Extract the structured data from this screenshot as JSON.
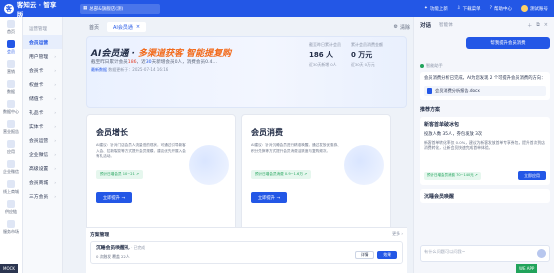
{
  "topbar": {
    "logo_text": "客知云 · 智享版",
    "logo_mark": "客",
    "store_name": "总部&旗舰店(测)",
    "actions": [
      "功能上新",
      "下载菜单",
      "帮助中心",
      "测试账号"
    ]
  },
  "iconbar": {
    "items": [
      {
        "label": "首页",
        "icon": "home-icon"
      },
      {
        "label": "会员",
        "icon": "member-icon",
        "active": true
      },
      {
        "label": "营销",
        "icon": "marketing-icon"
      },
      {
        "label": "数据",
        "icon": "data-icon"
      },
      {
        "label": "数据中心",
        "icon": "chart-icon"
      },
      {
        "label": "营业报告",
        "icon": "report-icon"
      },
      {
        "label": "应用",
        "icon": "app-icon"
      },
      {
        "label": "企业微信",
        "icon": "wechat-icon"
      },
      {
        "label": "线上商城",
        "icon": "mall-icon"
      },
      {
        "label": "供应链",
        "icon": "supply-icon"
      },
      {
        "label": "服务市场",
        "icon": "market-icon"
      }
    ]
  },
  "submenu": {
    "title": "运营管理",
    "items": [
      {
        "label": "会员运营",
        "active": true,
        "caret": ""
      },
      {
        "label": "用户管理",
        "caret": "›"
      },
      {
        "label": "会员卡",
        "caret": "›"
      },
      {
        "label": "权益卡",
        "caret": "›"
      },
      {
        "label": "储值卡",
        "caret": "›"
      },
      {
        "label": "礼品卡",
        "caret": "›"
      },
      {
        "label": "实体卡",
        "caret": "›"
      },
      {
        "label": "会员运营",
        "caret": "›"
      },
      {
        "label": "企业微信",
        "caret": "›"
      },
      {
        "label": "高级设置",
        "caret": "›"
      },
      {
        "label": "会员商城",
        "caret": "›"
      },
      {
        "label": "三方会员",
        "caret": "›"
      }
    ]
  },
  "tabs": {
    "items": [
      {
        "label": "首页",
        "active": false
      },
      {
        "label": "AI会员通",
        "active": true
      }
    ],
    "close_glyph": "×",
    "clear_label": "清除"
  },
  "hero": {
    "title_plain": "AI会员通 · ",
    "title_highlight": "多渠道获客 智能提复购",
    "sub_prefix": "截至昨日累计会员",
    "sub_num1": "186",
    "sub_mid": "，近",
    "sub_num2": "30",
    "sub_suffix": "天新增会员0人，消费会员0.4…",
    "meta_prefix": "最新数据",
    "meta_text": "数据更新于：2025-07-14 16:16",
    "stat1": {
      "label": "截至昨日累计会员",
      "value": "186 人",
      "foot": "近30天新增 0人"
    },
    "stat2": {
      "label": "累计会员消费金额",
      "value": "0 万元",
      "foot": "近30天 0万元"
    }
  },
  "cards": [
    {
      "title": "会员增长",
      "desc": "AI建议：针对门店会员人流量低的现状，可通过引导新客入会、拉新裂变等方式提升会员规模，建议优先开展入会有礼活动。",
      "tag": "预计日增会员 10~21 ↗",
      "button": "立即提升 →"
    },
    {
      "title": "会员消费",
      "desc": "AI建议：针对沉睡会员进行精准唤醒，通过发放优惠券、积分兑换等方式提升会员消费活跃度与复购频次。",
      "tag": "预计日增会员消费 0.9~1.6万 ↗",
      "button": "立即提升 →"
    }
  ],
  "plan": {
    "title": "方案管理",
    "more": "更多 ›",
    "item_name": "沉睡会员唤醒礼",
    "item_status": "· 已完成",
    "item_stats": "0 次触发   覆盖 22人",
    "detail_btn": "详情",
    "effect_btn": "效果"
  },
  "chat": {
    "tab_active": "对话",
    "tab_inactive": "智能体",
    "head_icons": [
      "＋",
      "⧉",
      "×"
    ],
    "user_message": "帮我提升会员消费",
    "assistant_name": "智能助手",
    "assistant_text": "会员消费分析已完成，AI为您发现 2 个可提升会员消费的方向：",
    "doc_name": "会员消费分析报告.docx",
    "reco_title": "推荐方案",
    "reco_name": "新客首单破冰包",
    "reco_target": "投放人数 35人，券包发放 3次",
    "reco_text": "新客首单转化率仅 0.0%，建议为新客发放首单专享券包，提升首次到店消费转化，让新会员快速完成首单体验。",
    "reco_tag": "预计日增会员消费 70~140元 ↗",
    "reco_apply": "立即应用",
    "reco2_name": "沉睡会员唤醒",
    "input_placeholder": "有什么问题可以问我~"
  },
  "badges": {
    "left": "MOCK",
    "right": "WE APP"
  },
  "colors": {
    "primary": "#2357e6",
    "highlight": "#f26a1b",
    "success": "#21a35b"
  }
}
